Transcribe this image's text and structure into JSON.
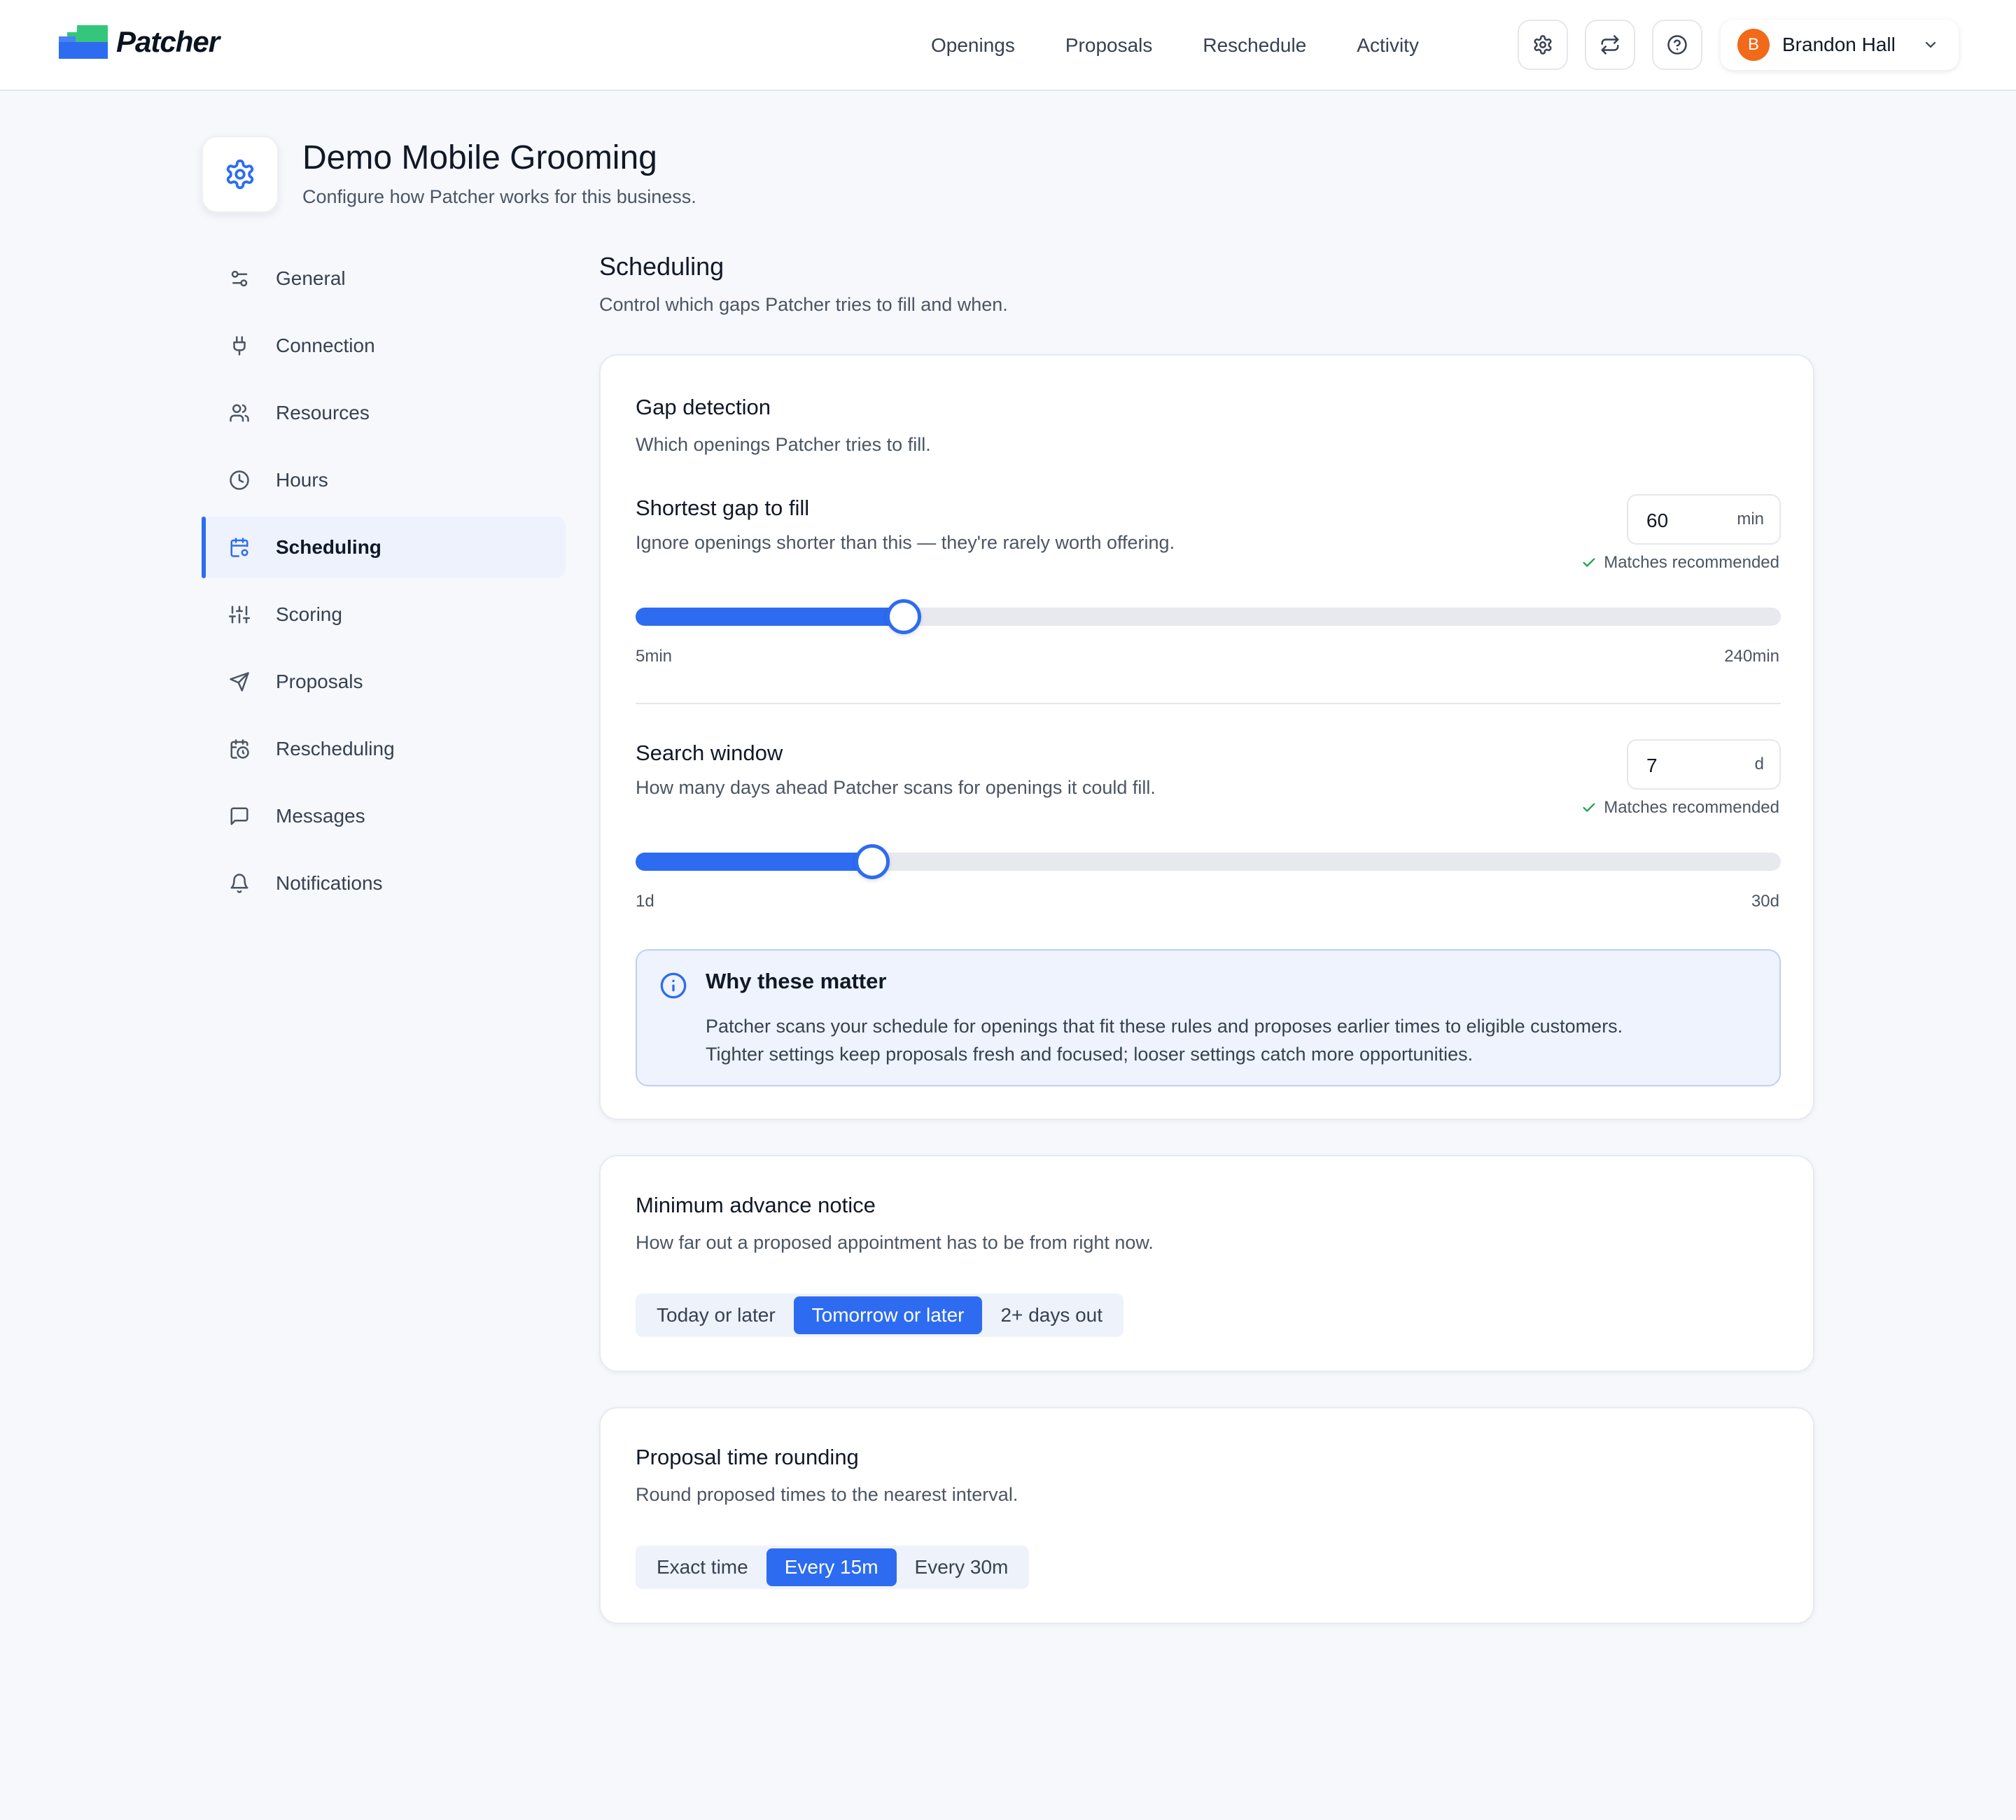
{
  "app": {
    "brand": "Patcher"
  },
  "nav": [
    "Openings",
    "Proposals",
    "Reschedule",
    "Activity"
  ],
  "user": {
    "initial": "B",
    "name": "Brandon Hall"
  },
  "page": {
    "title": "Demo Mobile Grooming",
    "subtitle": "Configure how Patcher works for this business."
  },
  "sidebar": {
    "active": "Scheduling",
    "items": [
      {
        "label": "General",
        "icon": "sliders-icon"
      },
      {
        "label": "Connection",
        "icon": "plug-icon"
      },
      {
        "label": "Resources",
        "icon": "users-icon"
      },
      {
        "label": "Hours",
        "icon": "clock-icon"
      },
      {
        "label": "Scheduling",
        "icon": "calendar-settings-icon"
      },
      {
        "label": "Scoring",
        "icon": "adjustments-icon"
      },
      {
        "label": "Proposals",
        "icon": "send-icon"
      },
      {
        "label": "Rescheduling",
        "icon": "calendar-clock-icon"
      },
      {
        "label": "Messages",
        "icon": "message-icon"
      },
      {
        "label": "Notifications",
        "icon": "bell-icon"
      }
    ]
  },
  "section": {
    "title": "Scheduling",
    "subtitle": "Control which gaps Patcher tries to fill and when."
  },
  "gap_detection": {
    "title": "Gap detection",
    "desc": "Which openings Patcher tries to fill.",
    "shortest_gap": {
      "title": "Shortest gap to fill",
      "desc": "Ignore openings shorter than this — they're rarely worth offering.",
      "value": "60",
      "unit": "min",
      "recommended": "Matches recommended",
      "min_label": "5min",
      "max_label": "240min",
      "min": 5,
      "max": 240,
      "current": 60
    },
    "search_window": {
      "title": "Search window",
      "desc": "How many days ahead Patcher scans for openings it could fill.",
      "value": "7",
      "unit": "d",
      "recommended": "Matches recommended",
      "min_label": "1d",
      "max_label": "30d",
      "min": 1,
      "max": 30,
      "current": 7
    },
    "info": {
      "title": "Why these matter",
      "line1": "Patcher scans your schedule for openings that fit these rules and proposes earlier times to eligible customers.",
      "line2": "Tighter settings keep proposals fresh and focused; looser settings catch more opportunities."
    }
  },
  "advance_notice": {
    "title": "Minimum advance notice",
    "desc": "How far out a proposed appointment has to be from right now.",
    "options": [
      "Today or later",
      "Tomorrow or later",
      "2+ days out"
    ],
    "selected": 1
  },
  "rounding": {
    "title": "Proposal time rounding",
    "desc": "Round proposed times to the nearest interval.",
    "options": [
      "Exact time",
      "Every 15m",
      "Every 30m"
    ],
    "selected": 1
  },
  "colors": {
    "accent": "#2d6cf0",
    "brand_green": "#34c77b",
    "avatar": "#f06a1a",
    "success": "#16a34a"
  }
}
